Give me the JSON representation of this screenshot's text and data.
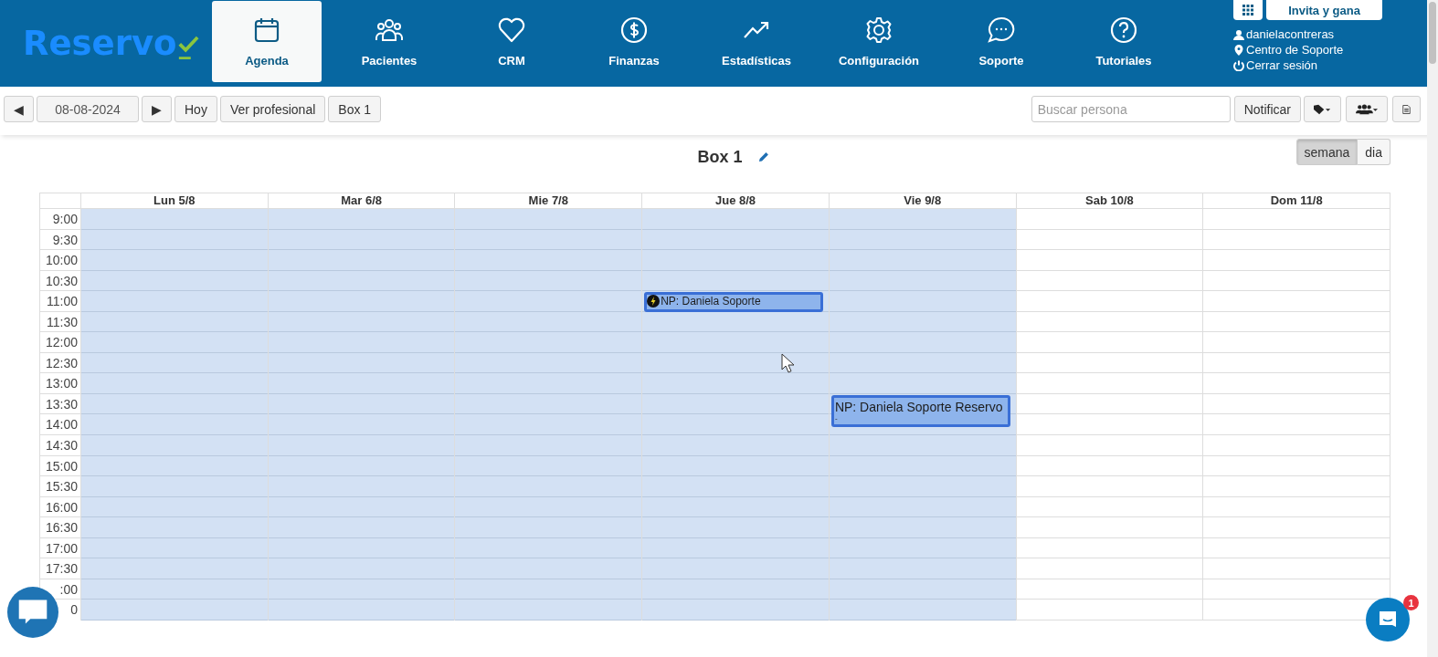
{
  "header": {
    "logo": "Reservo",
    "nav": [
      {
        "label": "Agenda",
        "selected": true
      },
      {
        "label": "Pacientes",
        "selected": false
      },
      {
        "label": "CRM",
        "selected": false
      },
      {
        "label": "Finanzas",
        "selected": false
      },
      {
        "label": "Estadísticas",
        "selected": false
      },
      {
        "label": "Configuración",
        "selected": false
      },
      {
        "label": "Soporte",
        "selected": false
      },
      {
        "label": "Tutoriales",
        "selected": false
      }
    ],
    "invite_button": "Invita y gana",
    "user_links": [
      "danielacontreras",
      "Centro de Soporte",
      "Cerrar sesión"
    ]
  },
  "toolbar": {
    "prev": "◀",
    "date": "08-08-2024",
    "next": "▶",
    "buttons": [
      "Hoy",
      "Ver profesional",
      "Box 1"
    ],
    "search": {
      "placeholder": "Buscar persona"
    },
    "notify_button": "Notificar"
  },
  "calendar": {
    "title": "Box 1",
    "views": [
      {
        "label": "semana",
        "selected": true
      },
      {
        "label": "dia",
        "selected": false
      }
    ],
    "days": [
      {
        "label": "Lun 5/8",
        "available": true
      },
      {
        "label": "Mar 6/8",
        "available": true
      },
      {
        "label": "Mie 7/8",
        "available": true
      },
      {
        "label": "Jue 8/8",
        "available": true
      },
      {
        "label": "Vie 9/8",
        "available": true
      },
      {
        "label": "Sab 10/8",
        "available": false
      },
      {
        "label": "Dom 11/8",
        "available": false
      }
    ],
    "rows": [
      {
        "time": "9:00"
      },
      {
        "time": "9:30"
      },
      {
        "time": "10:00"
      },
      {
        "time": "10:30"
      },
      {
        "time": "11:00",
        "cells": [
          null,
          null,
          null,
          {
            "kind": "flash",
            "title": "NP: Daniela Soporte"
          },
          null,
          null,
          null
        ]
      },
      {
        "time": "11:30"
      },
      {
        "time": "12:00"
      },
      {
        "time": "12:30"
      },
      {
        "time": "13:00"
      },
      {
        "time": "13:30",
        "cells": [
          null,
          null,
          null,
          null,
          {
            "kind": "plain",
            "title": "NP: Daniela Soporte Reservo",
            "note": "-"
          },
          null,
          null
        ]
      },
      {
        "time": "14:00"
      },
      {
        "time": "14:30"
      },
      {
        "time": "15:00"
      },
      {
        "time": "15:30"
      },
      {
        "time": "16:00"
      },
      {
        "time": "16:30"
      },
      {
        "time": "17:00"
      },
      {
        "time": "17:30"
      },
      {
        "time": ":00"
      },
      {
        "time": "0"
      }
    ]
  },
  "chat": {
    "unread": "1"
  }
}
